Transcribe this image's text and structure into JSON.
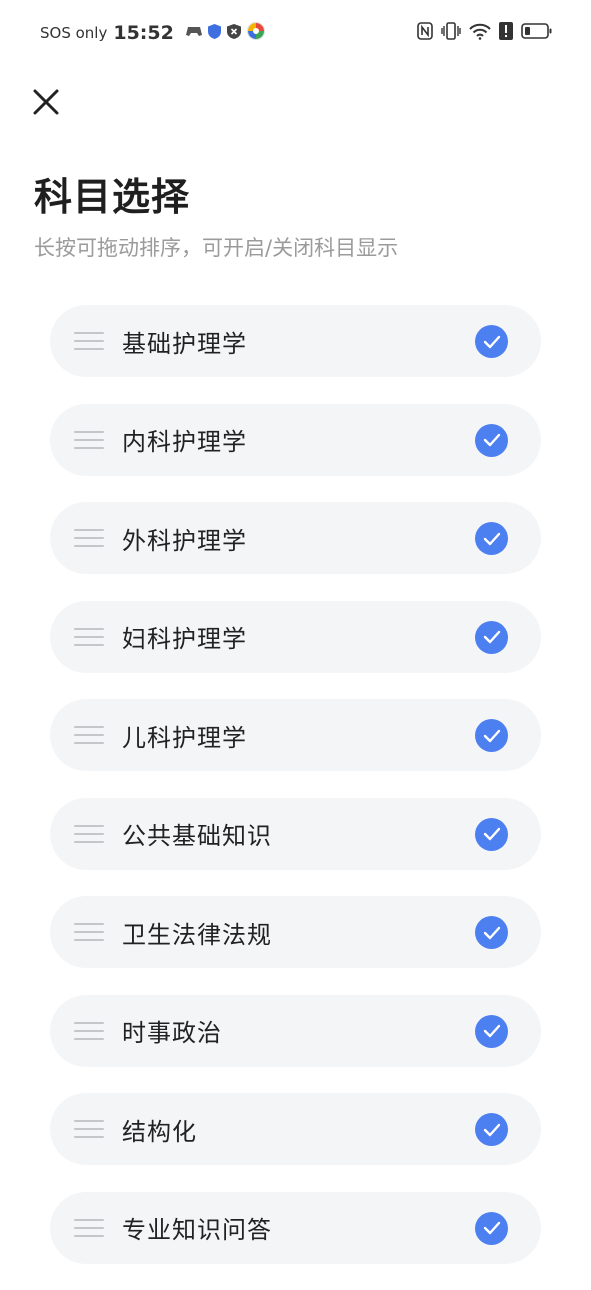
{
  "status_bar": {
    "carrier": "SOS only",
    "time": "15:52"
  },
  "header": {
    "title": "科目选择",
    "subtitle": "长按可拖动排序，可开启/关闭科目显示"
  },
  "subjects": [
    {
      "label": "基础护理学",
      "checked": true
    },
    {
      "label": "内科护理学",
      "checked": true
    },
    {
      "label": "外科护理学",
      "checked": true
    },
    {
      "label": "妇科护理学",
      "checked": true
    },
    {
      "label": "儿科护理学",
      "checked": true
    },
    {
      "label": "公共基础知识",
      "checked": true
    },
    {
      "label": "卫生法律法规",
      "checked": true
    },
    {
      "label": "时事政治",
      "checked": true
    },
    {
      "label": "结构化",
      "checked": true
    },
    {
      "label": "专业知识问答",
      "checked": true
    }
  ],
  "colors": {
    "accent": "#4c7ff0",
    "item_background": "#f4f5f7",
    "subtitle": "#9b9b9b"
  }
}
